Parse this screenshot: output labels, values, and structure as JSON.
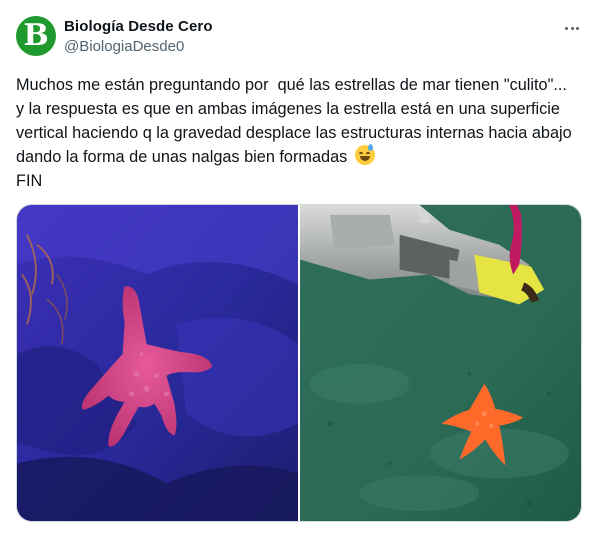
{
  "user": {
    "avatar_letter": "B",
    "avatar_color": "#1f9a2e",
    "display_name": "Biología Desde Cero",
    "handle": "@BiologiaDesde0"
  },
  "tweet": {
    "text": "Muchos me están preguntando por  qué las estrellas de mar tienen \"culito\"... y la respuesta es que en ambas imágenes la estrella está en una superficie vertical haciendo q la gravedad desplace las estructuras internas hacia abajo dando la forma de unas nalgas bien formadas",
    "emoji": "sweat-smile-emoji",
    "text_end": "FIN"
  },
  "menu": {
    "icon": "more-dots-icon"
  },
  "media": [
    {
      "icon": "photo",
      "description_name": "pink starfish on blue rock"
    },
    {
      "icon": "photo",
      "description_name": "orange starfish with robotic arm on seafloor"
    }
  ]
}
